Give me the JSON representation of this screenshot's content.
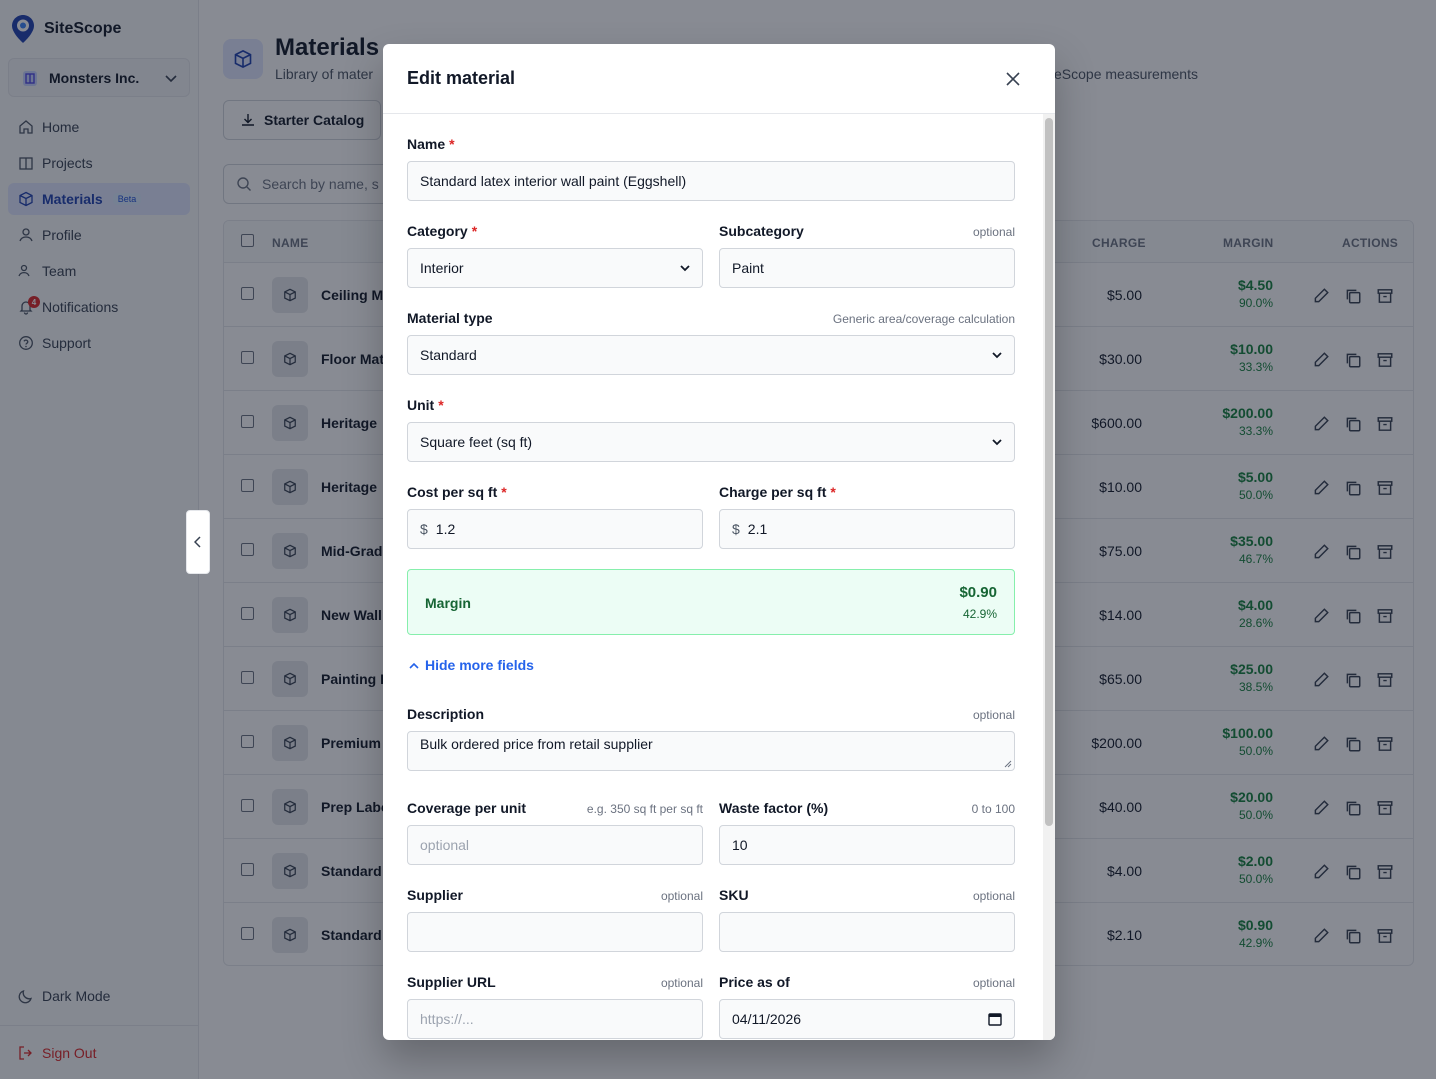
{
  "app": {
    "name": "SiteScope"
  },
  "org": {
    "name": "Monsters Inc."
  },
  "nav": {
    "items": [
      {
        "label": "Home",
        "icon": "home-icon"
      },
      {
        "label": "Projects",
        "icon": "building-icon"
      },
      {
        "label": "Materials",
        "icon": "cube-icon",
        "badge": "Beta",
        "active": true
      },
      {
        "label": "Profile",
        "icon": "user-icon"
      },
      {
        "label": "Team",
        "icon": "users-icon"
      },
      {
        "label": "Notifications",
        "icon": "bell-icon",
        "count": "4"
      },
      {
        "label": "Support",
        "icon": "help-icon"
      }
    ],
    "dark_mode": "Dark Mode",
    "sign_out": "Sign Out"
  },
  "page": {
    "title": "Materials",
    "subtitle_left": "Library of mater",
    "subtitle_right": "eScope measurements",
    "starter_catalog": "Starter Catalog",
    "search_placeholder": "Search by name, s"
  },
  "table": {
    "headers": {
      "name": "NAME",
      "charge": "CHARGE",
      "margin": "MARGIN",
      "actions": "ACTIONS"
    },
    "rows": [
      {
        "name": "Ceiling M",
        "charge": "$5.00",
        "margin": "$4.50",
        "margin_pct": "90.0%"
      },
      {
        "name": "Floor Mat",
        "charge": "$30.00",
        "margin": "$10.00",
        "margin_pct": "33.3%"
      },
      {
        "name": "Heritage",
        "charge": "$600.00",
        "margin": "$200.00",
        "margin_pct": "33.3%"
      },
      {
        "name": "Heritage ",
        "charge": "$10.00",
        "margin": "$5.00",
        "margin_pct": "50.0%"
      },
      {
        "name": "Mid-Grad",
        "charge": "$75.00",
        "margin": "$35.00",
        "margin_pct": "46.7%"
      },
      {
        "name": "New Wall",
        "charge": "$14.00",
        "margin": "$4.00",
        "margin_pct": "28.6%"
      },
      {
        "name": "Painting L",
        "charge": "$65.00",
        "margin": "$25.00",
        "margin_pct": "38.5%"
      },
      {
        "name": "Premium",
        "charge": "$200.00",
        "margin": "$100.00",
        "margin_pct": "50.0%"
      },
      {
        "name": "Prep Labo",
        "charge": "$40.00",
        "margin": "$20.00",
        "margin_pct": "50.0%"
      },
      {
        "name": "Standard",
        "charge": "$4.00",
        "margin": "$2.00",
        "margin_pct": "50.0%"
      },
      {
        "name": "Standard",
        "charge": "$2.10",
        "margin": "$0.90",
        "margin_pct": "42.9%"
      }
    ]
  },
  "modal": {
    "title": "Edit material",
    "name": {
      "label": "Name",
      "value": "Standard latex interior wall paint (Eggshell)"
    },
    "category": {
      "label": "Category",
      "value": "Interior"
    },
    "subcategory": {
      "label": "Subcategory",
      "hint": "optional",
      "value": "Paint"
    },
    "material_type": {
      "label": "Material type",
      "hint": "Generic area/coverage calculation",
      "value": "Standard"
    },
    "unit": {
      "label": "Unit",
      "value": "Square feet (sq ft)"
    },
    "cost": {
      "label": "Cost per sq ft",
      "currency": "$",
      "value": "1.2"
    },
    "charge": {
      "label": "Charge per sq ft",
      "currency": "$",
      "value": "2.1"
    },
    "margin": {
      "label": "Margin",
      "amount": "$0.90",
      "pct": "42.9%"
    },
    "toggle": "Hide more fields",
    "description": {
      "label": "Description",
      "hint": "optional",
      "value": "Bulk ordered price from retail supplier"
    },
    "coverage": {
      "label": "Coverage per unit",
      "hint": "e.g. 350 sq ft per sq ft",
      "placeholder": "optional"
    },
    "waste": {
      "label": "Waste factor (%)",
      "hint": "0 to 100",
      "value": "10"
    },
    "supplier": {
      "label": "Supplier",
      "hint": "optional",
      "value": ""
    },
    "sku": {
      "label": "SKU",
      "hint": "optional",
      "value": ""
    },
    "supplier_url": {
      "label": "Supplier URL",
      "hint": "optional",
      "placeholder": "https://..."
    },
    "price_as_of": {
      "label": "Price as of",
      "hint": "optional",
      "value": "04/11/2026"
    }
  },
  "colors": {
    "accent": "#2563eb",
    "margin_green": "#15803d",
    "required": "#dc2626",
    "danger": "#dc2626"
  }
}
